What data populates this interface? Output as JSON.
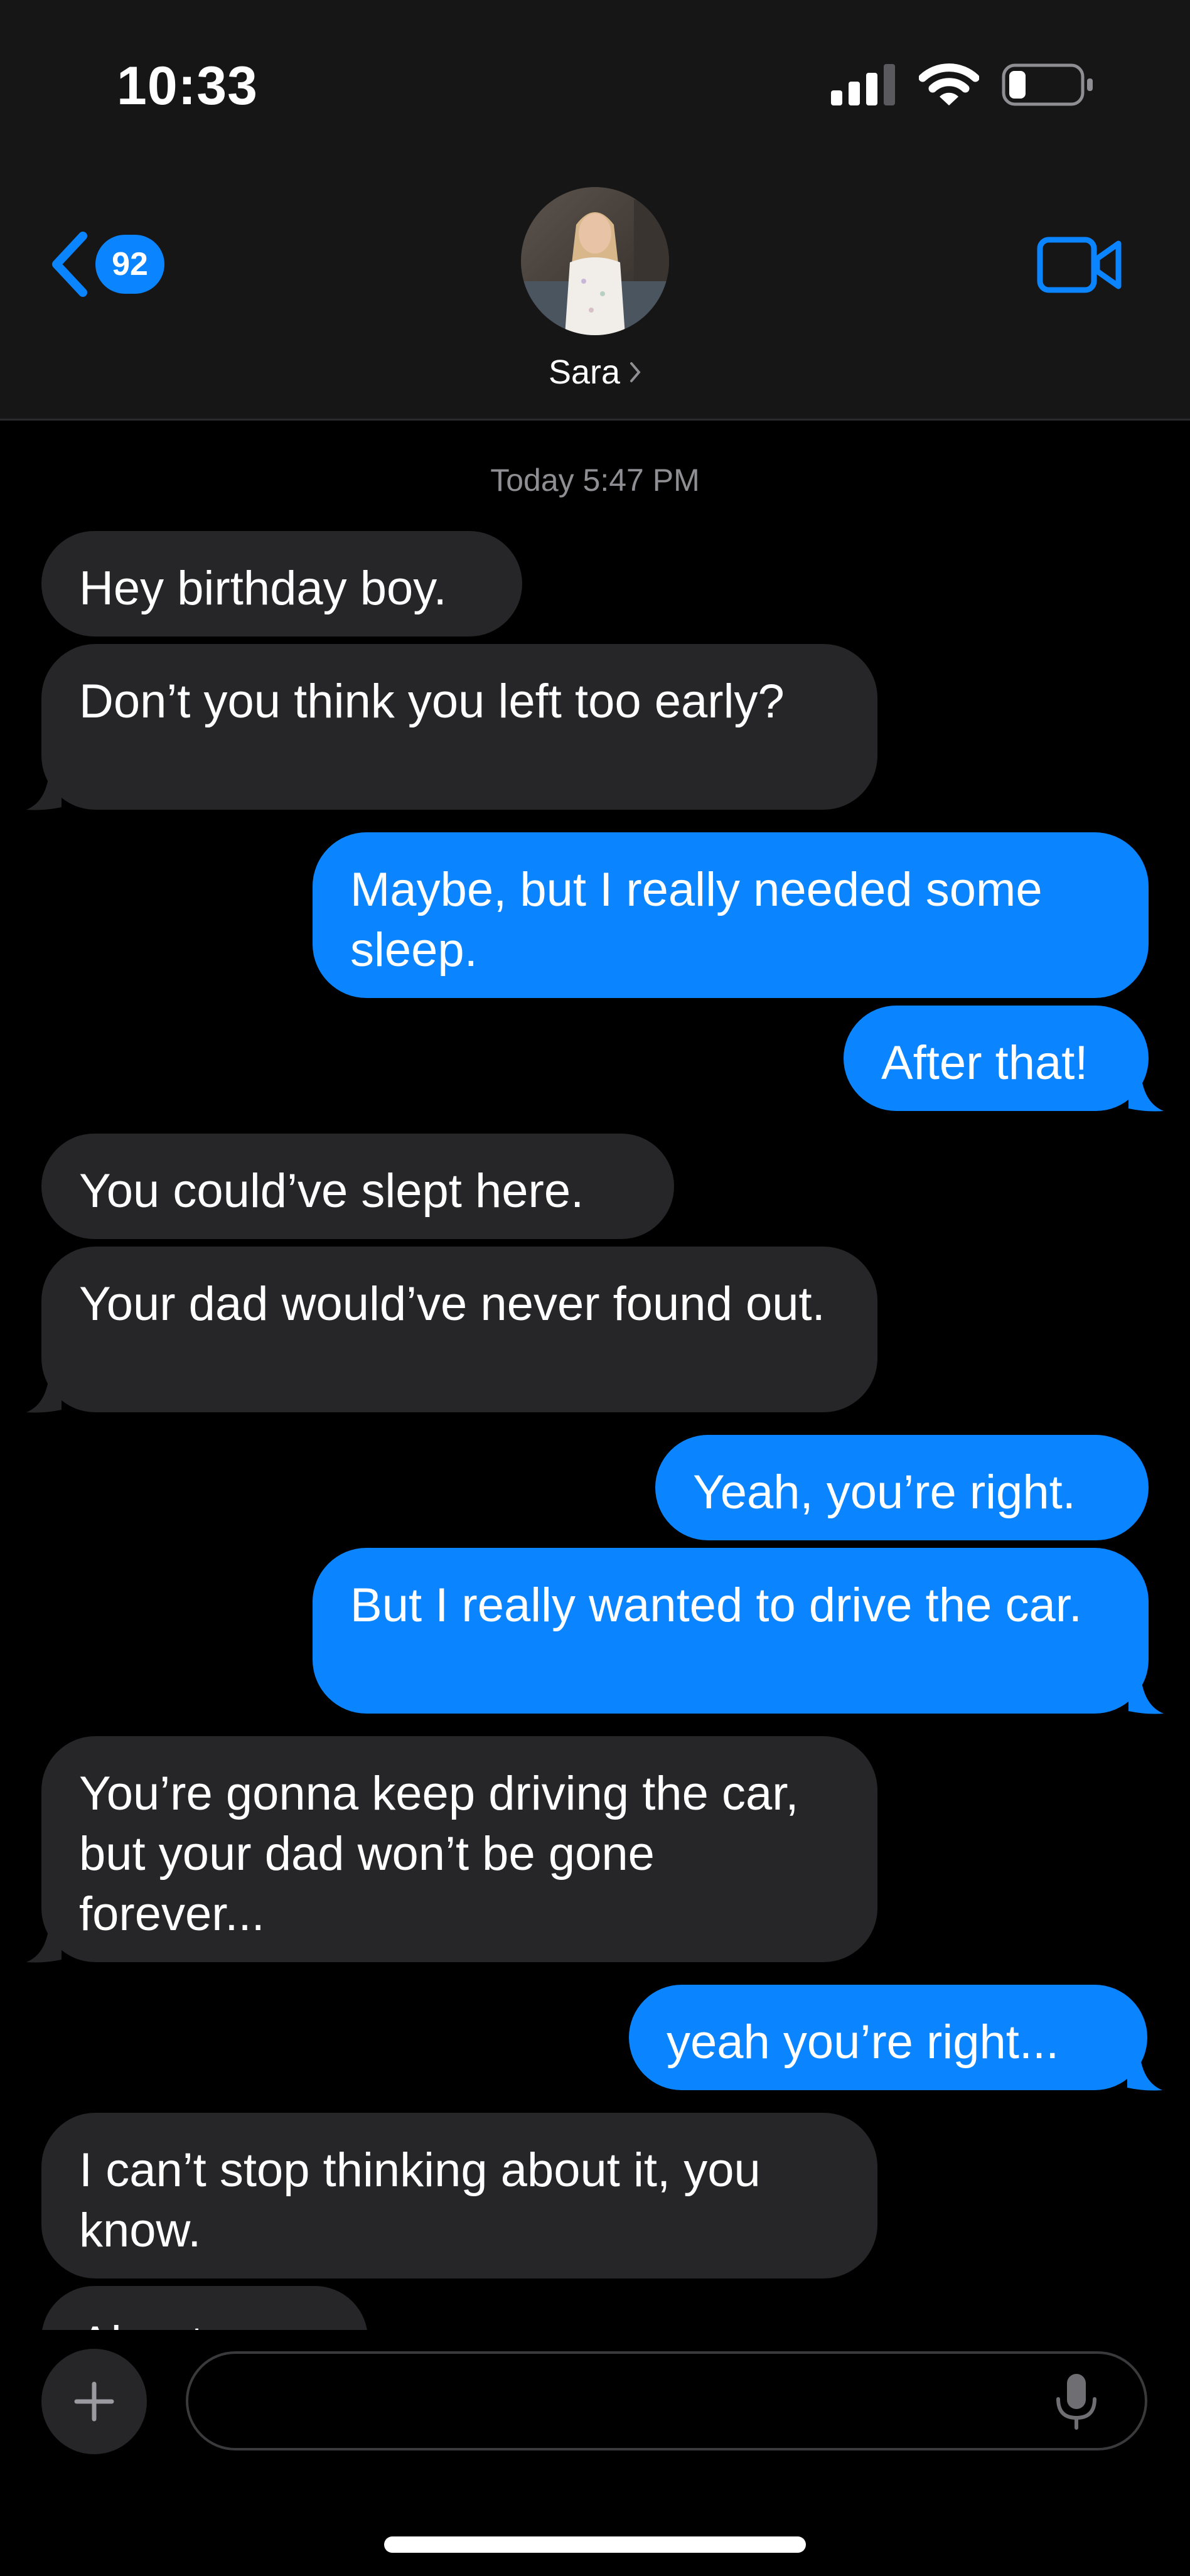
{
  "status_bar": {
    "time": "10:33",
    "icons": [
      "cellular-signal-icon",
      "wifi-icon",
      "battery-icon"
    ]
  },
  "header": {
    "unread_count": "92",
    "contact_name": "Sara",
    "icons": [
      "chevron-left-icon",
      "chevron-right-icon",
      "video-camera-icon"
    ]
  },
  "conversation": {
    "timestamp": "Today 5:47 PM",
    "messages": [
      {
        "direction": "incoming",
        "text": "Hey birthday boy."
      },
      {
        "direction": "incoming",
        "text": "Don’t you think you left too early?"
      },
      {
        "direction": "outgoing",
        "text": "Maybe, but I really needed some sleep."
      },
      {
        "direction": "outgoing",
        "text": "After that!"
      },
      {
        "direction": "incoming",
        "text": "You could’ve slept here."
      },
      {
        "direction": "incoming",
        "text": "Your dad would’ve never found out."
      },
      {
        "direction": "outgoing",
        "text": "Yeah, you’re right."
      },
      {
        "direction": "outgoing",
        "text": "But I really wanted to drive the car."
      },
      {
        "direction": "incoming",
        "text": "You’re gonna keep driving the car, but your dad won’t be gone forever..."
      },
      {
        "direction": "outgoing",
        "text": "yeah you’re right..."
      },
      {
        "direction": "incoming",
        "text": "I can’t stop thinking about it, you know."
      },
      {
        "direction": "incoming",
        "text": "About you"
      }
    ]
  },
  "composer": {
    "placeholder": "",
    "icons": [
      "plus-icon",
      "microphone-icon"
    ]
  },
  "colors": {
    "accent": "#0a84ff",
    "incoming_bubble": "#262628",
    "header_background": "#161616",
    "background": "#000000",
    "timestamp": "#8e8e93"
  }
}
